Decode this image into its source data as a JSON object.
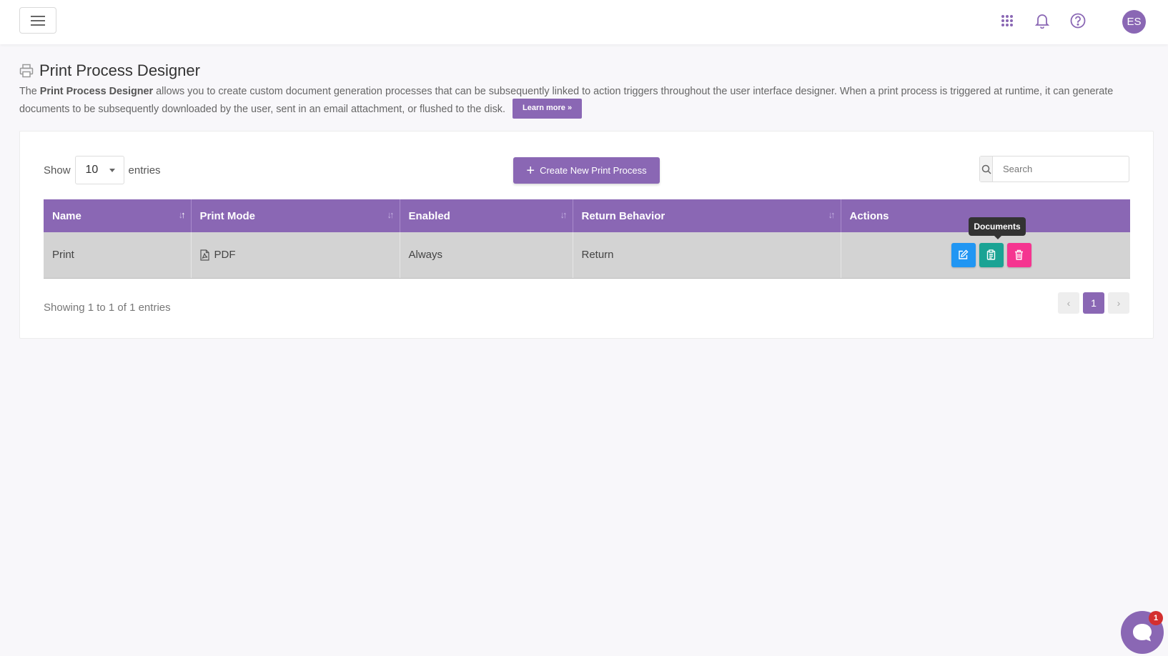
{
  "topbar": {
    "menu_icon": "hamburger-icon",
    "apps_icon": "grid-icon",
    "notifications_icon": "bell-icon",
    "help_icon": "help-icon",
    "avatar_initials": "ES"
  },
  "header": {
    "icon": "printer-icon",
    "title": "Print Process Designer",
    "desc_intro": "The ",
    "desc_bold": "Print Process Designer",
    "desc_rest": " allows you to create custom document generation processes that can be subsequently linked to action triggers throughout the user interface designer. When a print process is triggered at runtime, it can generate documents to be subsequently downloaded by the user, sent in an email attachment, or flushed to the disk.",
    "learn_more": "Learn more »"
  },
  "controls": {
    "show_label": "Show",
    "entries_value": "10",
    "entries_label": "entries",
    "create_label": "Create New Print Process",
    "search_placeholder": "Search"
  },
  "table": {
    "columns": [
      "Name",
      "Print Mode",
      "Enabled",
      "Return Behavior",
      "Actions"
    ],
    "rows": [
      {
        "name": "Print",
        "print_mode": "PDF",
        "enabled": "Always",
        "return_behavior": "Return"
      }
    ]
  },
  "tooltip": "Documents",
  "footer": {
    "info": "Showing 1 to 1 of 1 entries",
    "current_page": "1"
  },
  "chat": {
    "badge": "1"
  },
  "colors": {
    "accent": "#8a67b4",
    "edit": "#2196f3",
    "documents": "#1aa394",
    "delete": "#f53590"
  }
}
